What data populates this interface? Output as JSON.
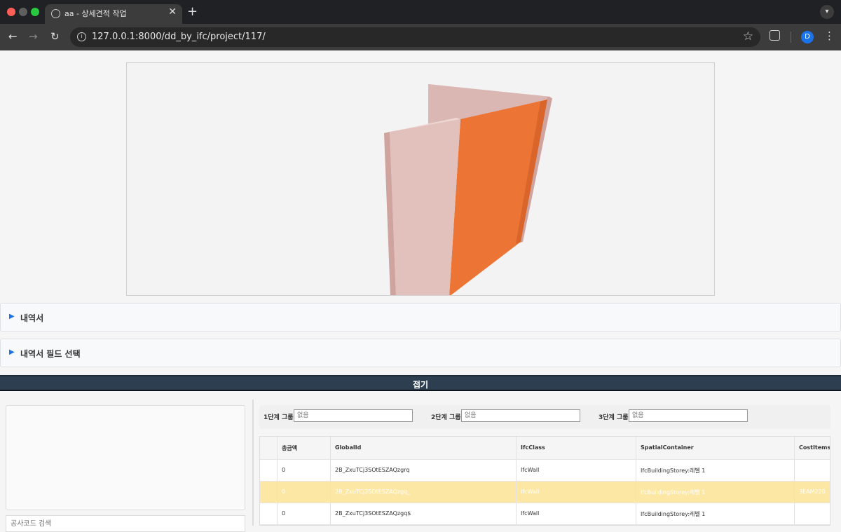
{
  "browser": {
    "tab_title": "aa - 상세견적 작업",
    "url": "127.0.0.1:8000/dd_by_ifc/project/117/",
    "profile_initial": "D"
  },
  "page": {
    "accordion_items": [
      "내역서",
      "내역서 필드 선택"
    ],
    "collapse_label": "접기",
    "code_search_placeholder": "공사코드 검색",
    "group_filters": [
      {
        "label": "1단계 그룹:",
        "placeholder": "없음"
      },
      {
        "label": "2단계 그룹:",
        "placeholder": "없음"
      },
      {
        "label": "3단계 그룹:",
        "placeholder": "없음"
      }
    ],
    "table": {
      "columns": [
        "",
        "총금액",
        "GlobalId",
        "IfcClass",
        "SpatialContainer",
        "CostItems"
      ],
      "rows": [
        {
          "total": "0",
          "global_id": "2B_ZxuTCj3SOtESZAQzgrq",
          "ifc_class": "IfcWall",
          "spatial": "IfcBuildingStorey:레벨 1",
          "cost_items": ""
        },
        {
          "total": "0",
          "global_id": "2B_ZxuTCj3SOtESZAQzgq_",
          "ifc_class": "IfcWall",
          "spatial": "IfcBuildingStorey:레벨 1",
          "cost_items": "3EAM220"
        },
        {
          "total": "0",
          "global_id": "2B_ZxuTCj3SOtESZAQzgq$",
          "ifc_class": "IfcWall",
          "spatial": "IfcBuildingStorey:레벨 1",
          "cost_items": ""
        }
      ],
      "selected_row_color": "#fde7a5"
    }
  },
  "colors": {
    "wall_pink": "#dbb7b3",
    "wall_highlight": "#ec7535",
    "header_bar": "#2c3e50",
    "accent": "#1a73e8"
  }
}
